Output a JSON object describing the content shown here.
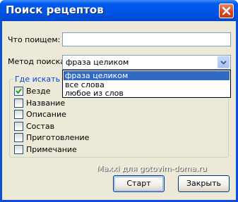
{
  "window": {
    "title": "Поиск рецептов"
  },
  "form": {
    "search_label": "Что поищем:",
    "search_value": "",
    "method_label": "Метод поиска",
    "method_selected": "фраза целиком",
    "method_options": [
      "фраза целиком",
      "все слова",
      "любое из слов"
    ]
  },
  "where": {
    "title": "Где искать",
    "fields": [
      {
        "label": "Везде",
        "checked": true
      },
      {
        "label": "Название",
        "checked": false
      },
      {
        "label": "Описание",
        "checked": false
      },
      {
        "label": "Состав",
        "checked": false
      },
      {
        "label": "Приготовление",
        "checked": false
      },
      {
        "label": "Примечание",
        "checked": false
      }
    ]
  },
  "buttons": {
    "start": "Старт",
    "close": "Закрыть"
  },
  "watermark": "Maxxi для gotovim-doma.ru",
  "colors": {
    "titlebar": "#0054e3",
    "client": "#ece9d8",
    "selection": "#316ac5",
    "group_title": "#0046d5",
    "close_button": "#d5431d"
  }
}
